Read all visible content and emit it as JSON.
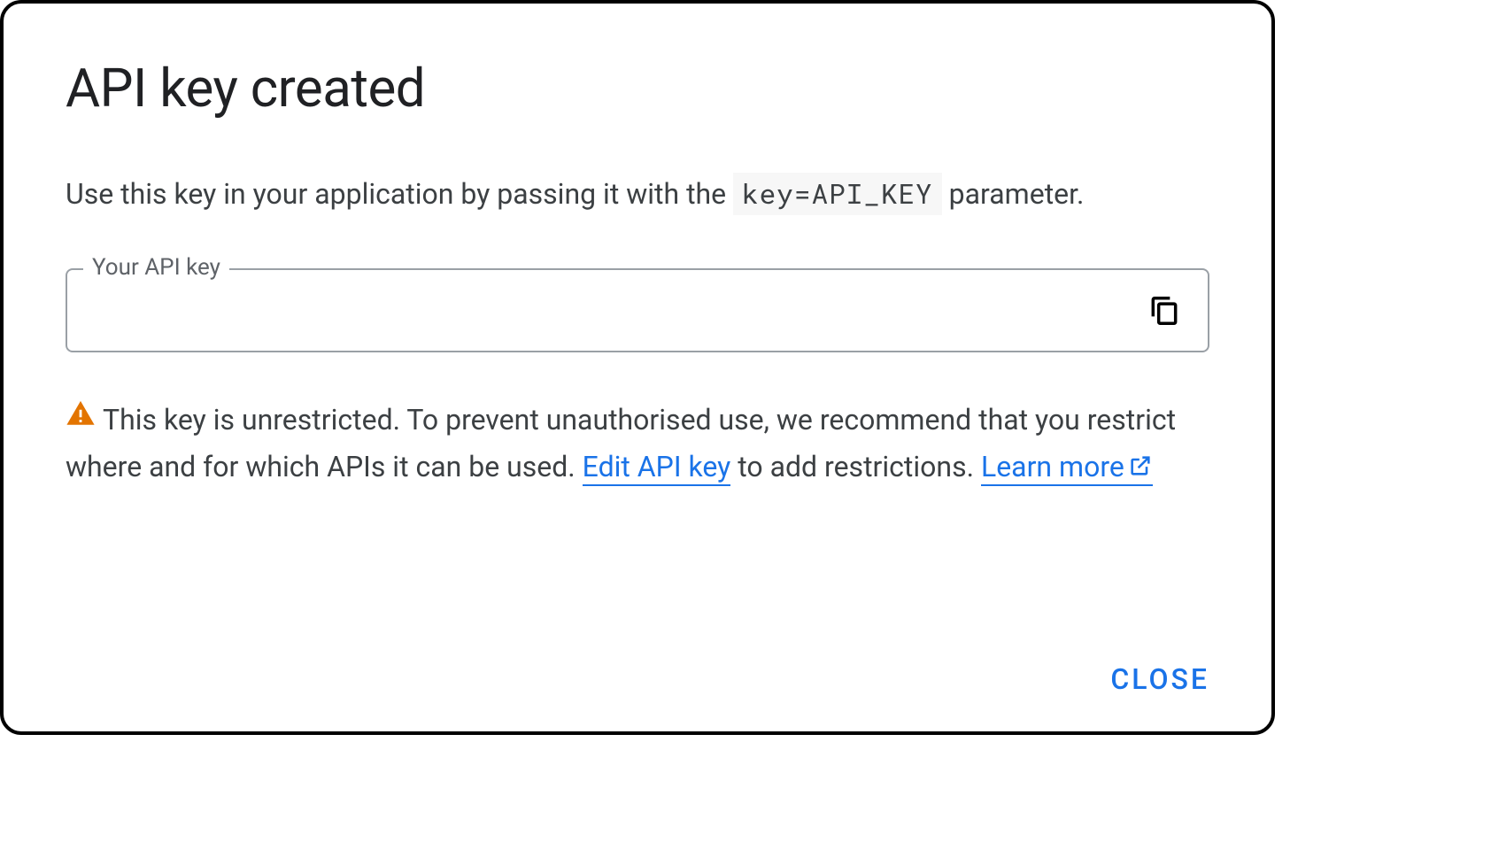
{
  "dialog": {
    "title": "API key created",
    "description_before": "Use this key in your application by passing it with the ",
    "code_param": "key=API_KEY",
    "description_after": " parameter.",
    "field_label": "Your API key",
    "api_key_value": "",
    "warning_text_1": "This key is unrestricted. To prevent unauthorised use, we recommend that you restrict where and for which APIs it can be used. ",
    "edit_link": "Edit API key",
    "warning_text_2": " to add restrictions. ",
    "learn_more_link": "Learn more",
    "close_label": "CLOSE"
  },
  "colors": {
    "primary_blue": "#1a73e8",
    "warning_orange": "#e37400",
    "text_primary": "#202124",
    "text_secondary": "#3c4043",
    "border_gray": "#9aa0a6"
  }
}
